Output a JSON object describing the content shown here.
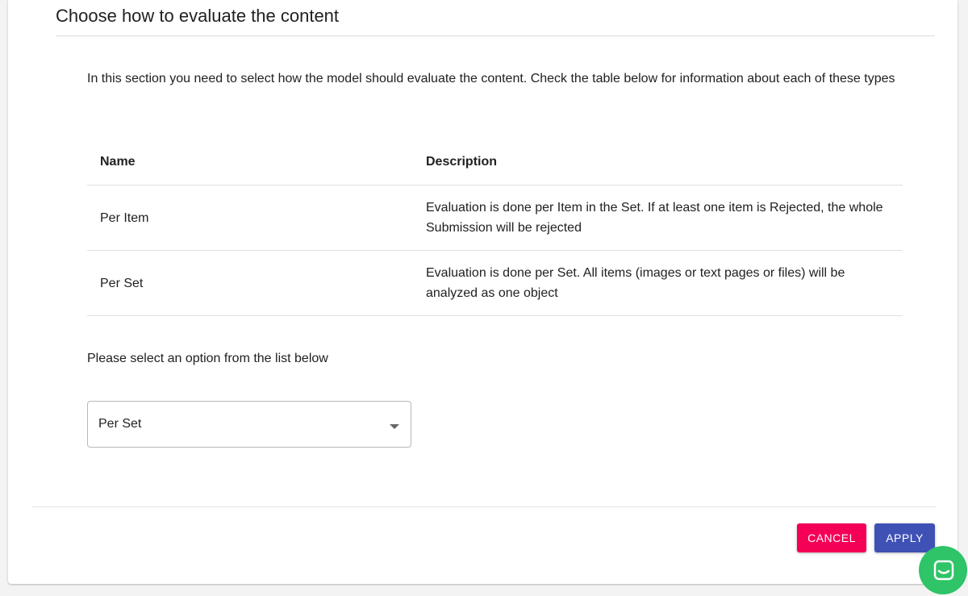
{
  "dialog": {
    "title": "Choose how to evaluate the content",
    "intro": "In this section you need to select how the model should evaluate the content. Check the table below for information about each of these types"
  },
  "table": {
    "headers": {
      "name": "Name",
      "description": "Description"
    },
    "rows": [
      {
        "name": "Per Item",
        "description": "Evaluation is done per Item in the Set. If at least one item is Rejected, the whole Submission will be rejected"
      },
      {
        "name": "Per Set",
        "description": "Evaluation is done per Set. All items (images or text pages or files) will be analyzed as one object"
      }
    ]
  },
  "selection": {
    "prompt": "Please select an option from the list below",
    "selected_value": "Per Set"
  },
  "actions": {
    "cancel_label": "CANCEL",
    "apply_label": "APPLY"
  },
  "colors": {
    "cancel": "#f50057",
    "apply": "#3f51b5",
    "chat": "#2ec467"
  },
  "icons": {
    "dropdown": "chevron-down-icon",
    "chat": "chat-icon"
  }
}
